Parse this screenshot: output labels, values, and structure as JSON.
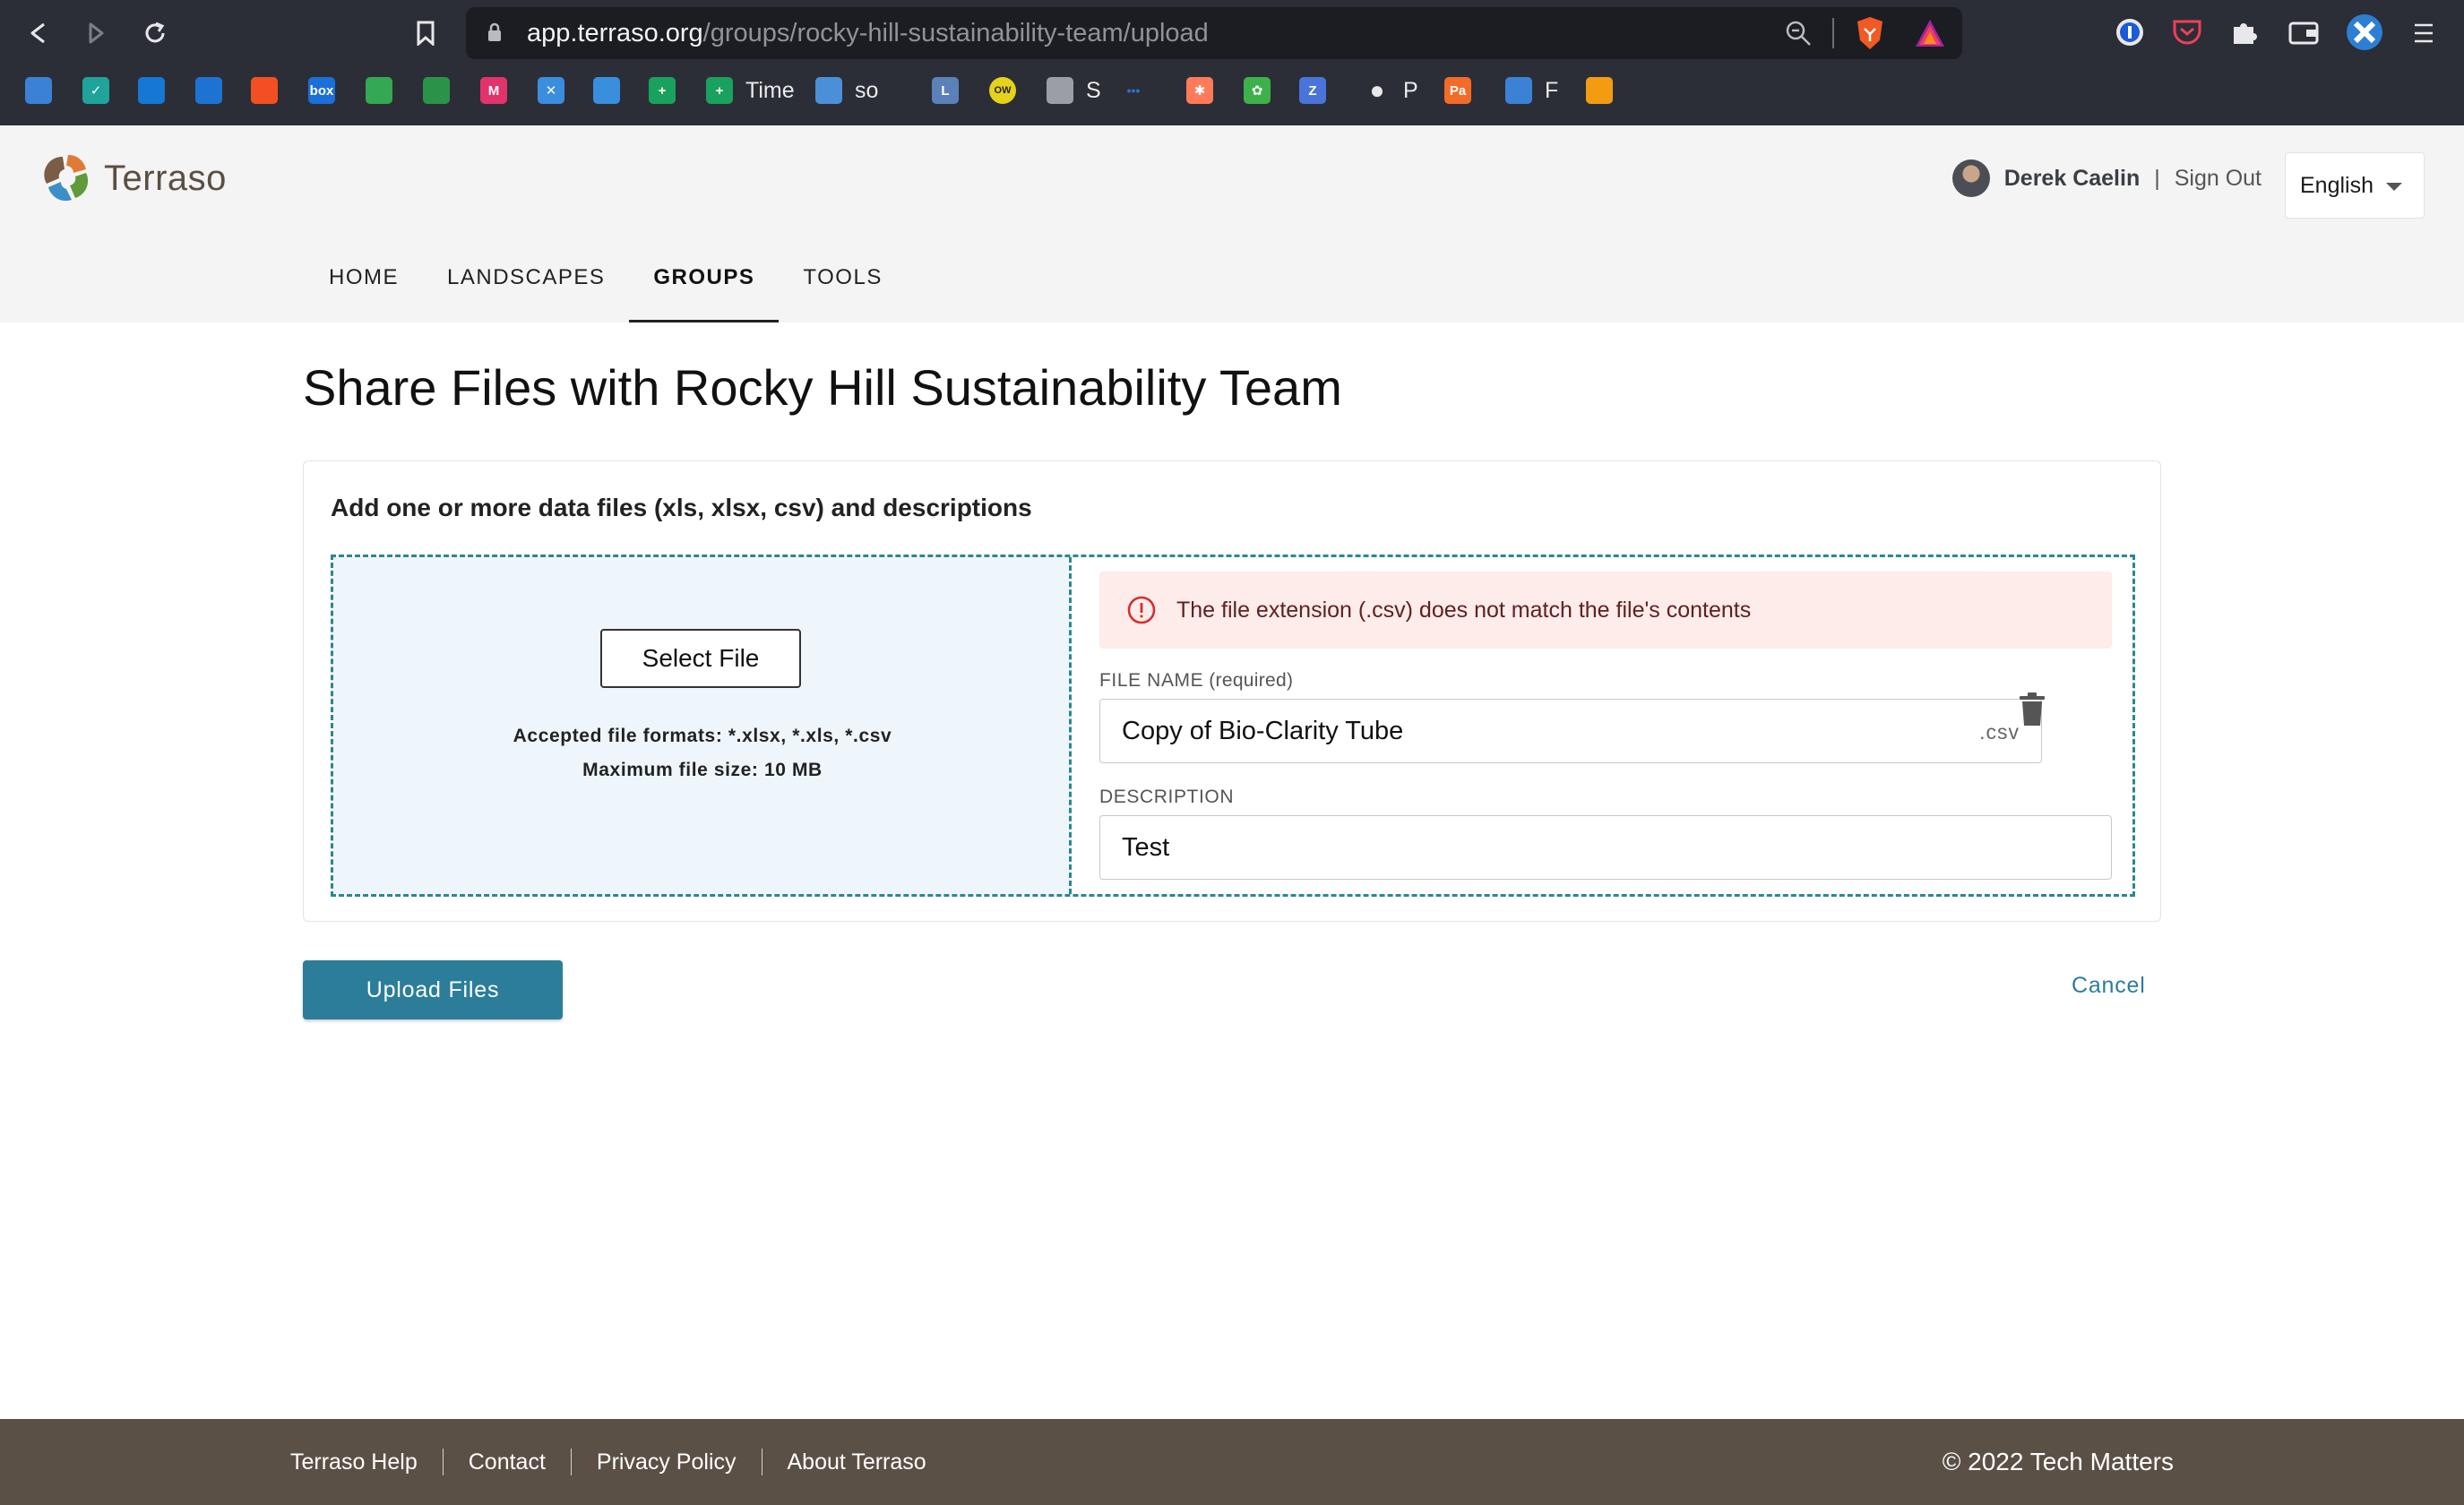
{
  "browser": {
    "url_host": "app.terraso.org",
    "url_path": "/groups/rocky-hill-sustainability-team/upload",
    "bookmarks": [
      {
        "icon": "cube-icon",
        "label": "",
        "color": "#3b82d6"
      },
      {
        "icon": "checkbox-icon",
        "label": "",
        "color": "#1fa39a"
      },
      {
        "icon": "outlook-icon",
        "label": "",
        "color": "#1677d4"
      },
      {
        "icon": "grid-blue-icon",
        "label": "",
        "color": "#1e73d2"
      },
      {
        "icon": "microsoft-icon",
        "label": "",
        "color": "#f25022"
      },
      {
        "icon": "box-icon",
        "label": "",
        "color": "#1a6fd8"
      },
      {
        "icon": "google-drive-icon",
        "label": "",
        "color": "#34a853"
      },
      {
        "icon": "sheet-green-icon",
        "label": "",
        "color": "#2b9348"
      },
      {
        "icon": "m-icon",
        "label": "",
        "color": "#e3336b"
      },
      {
        "icon": "star-cross-icon",
        "label": "",
        "color": "#3a8ede"
      },
      {
        "icon": "cloud-icon",
        "label": "",
        "color": "#3a8ede"
      },
      {
        "icon": "plus-sheet-icon",
        "label": "",
        "color": "#1aa15e"
      },
      {
        "icon": "plus-sheet-icon",
        "label": "Time",
        "color": "#1aa15e"
      },
      {
        "icon": "shoe-icon",
        "label": "so",
        "color": "#4b8fd8"
      },
      {
        "icon": "l-icon",
        "label": "",
        "color": "#5a82b8"
      },
      {
        "icon": "ow-icon",
        "label": "",
        "color": "#e6d21b"
      },
      {
        "icon": "folder-icon",
        "label": "S",
        "color": "#9b9ea5"
      },
      {
        "icon": "dots-icon",
        "label": "",
        "color": "#2f6fd1"
      },
      {
        "icon": "hubspot-icon",
        "label": "",
        "color": "#ff7a59"
      },
      {
        "icon": "tree-icon",
        "label": "",
        "color": "#3eb14a"
      },
      {
        "icon": "z-icon",
        "label": "",
        "color": "#4a74d9"
      },
      {
        "icon": "github-icon",
        "label": "P",
        "color": "#e8e8ea"
      },
      {
        "icon": "pa-icon",
        "label": "",
        "color": "#f26b29"
      },
      {
        "icon": "cube-icon",
        "label": "F",
        "color": "#3b82d6"
      },
      {
        "icon": "orange-app-icon",
        "label": "",
        "color": "#f39c12"
      }
    ]
  },
  "app": {
    "logo_text": "Terraso",
    "user_name": "Derek Caelin",
    "user_separator": "|",
    "sign_out": "Sign Out",
    "language": "English",
    "nav": [
      {
        "label": "HOME",
        "active": false
      },
      {
        "label": "LANDSCAPES",
        "active": false
      },
      {
        "label": "GROUPS",
        "active": true
      },
      {
        "label": "TOOLS",
        "active": false
      }
    ]
  },
  "page": {
    "title": "Share Files with Rocky Hill Sustainability Team",
    "card_heading": "Add one or more data files (xls, xlsx, csv) and descriptions",
    "select_file_label": "Select File",
    "accepted_formats": "Accepted file formats: *.xlsx, *.xls, *.csv",
    "max_size": "Maximum file size: 10 MB",
    "alert_text": "The file extension (.csv) does not match the file's contents",
    "file_name_label": "FILE NAME",
    "file_name_required": "(required)",
    "file_name_value": "Copy of Bio-Clarity Tube",
    "file_extension": ".csv",
    "description_label": "DESCRIPTION",
    "description_value": "Test",
    "upload_label": "Upload Files",
    "cancel_label": "Cancel"
  },
  "footer": {
    "links": [
      "Terraso Help",
      "Contact",
      "Privacy Policy",
      "About Terraso"
    ],
    "copyright": "© 2022 Tech Matters"
  },
  "colors": {
    "accent": "#2c7d9a",
    "drop_border": "#2b8790",
    "alert_bg": "#fdecea",
    "alert_icon": "#d32f2f",
    "footer_bg": "#5b5046",
    "header_bg": "#f4f4f4"
  }
}
